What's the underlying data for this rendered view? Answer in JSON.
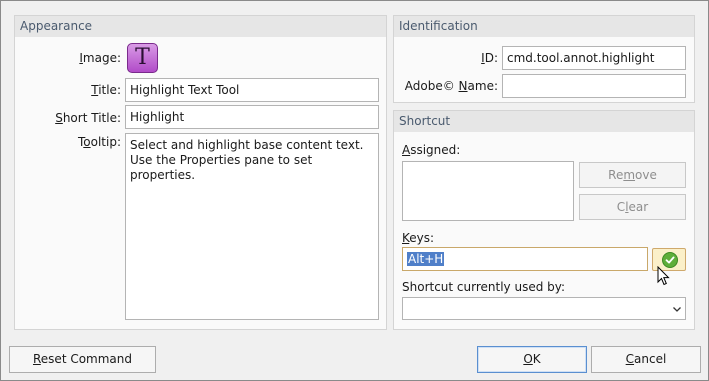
{
  "appearance": {
    "header": "Appearance",
    "image_label": "Image:",
    "image_icon_letter": "T",
    "title_label": "Title:",
    "title_value": "Highlight Text Tool",
    "short_title_label": "Short Title:",
    "short_title_value": "Highlight",
    "tooltip_label": "Tooltip:",
    "tooltip_line1": "Select and highlight base content text.",
    "tooltip_line2": "Use the Properties pane to set properties."
  },
  "identification": {
    "header": "Identification",
    "id_label": "ID:",
    "id_value": "cmd.tool.annot.highlight",
    "adobe_name_label": "Adobe© Name:",
    "adobe_name_value": ""
  },
  "shortcut": {
    "header": "Shortcut",
    "assigned_label": "Assigned:",
    "remove_label": "Remove",
    "clear_label": "Clear",
    "keys_label": "Keys:",
    "keys_value": "Alt+H",
    "used_by_label": "Shortcut currently used by:",
    "used_by_value": ""
  },
  "footer": {
    "reset_label": "Reset Command",
    "ok_label": "OK",
    "cancel_label": "Cancel"
  },
  "colors": {
    "group_header_text": "#4a5a6e",
    "selection": "#4f7fc9",
    "icon_purple": "#b14bc8",
    "check_green": "#5fae3a"
  }
}
